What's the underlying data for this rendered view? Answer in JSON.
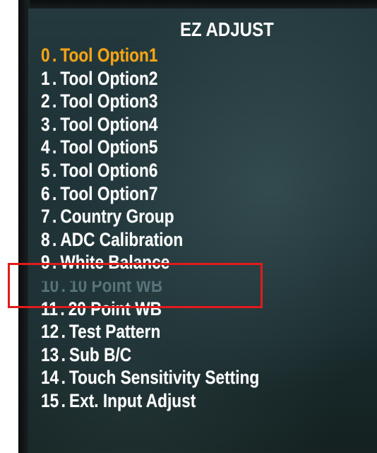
{
  "menu": {
    "title": "EZ ADJUST",
    "items": [
      {
        "num": "0",
        "label": "Tool Option1",
        "state": "selected"
      },
      {
        "num": "1",
        "label": "Tool Option2",
        "state": "normal"
      },
      {
        "num": "2",
        "label": "Tool Option3",
        "state": "normal"
      },
      {
        "num": "3",
        "label": "Tool Option4",
        "state": "normal"
      },
      {
        "num": "4",
        "label": "Tool Option5",
        "state": "normal"
      },
      {
        "num": "5",
        "label": "Tool Option6",
        "state": "normal"
      },
      {
        "num": "6",
        "label": "Tool Option7",
        "state": "normal"
      },
      {
        "num": "7",
        "label": "Country Group",
        "state": "normal"
      },
      {
        "num": "8",
        "label": "ADC Calibration",
        "state": "normal"
      },
      {
        "num": "9",
        "label": "White Balance",
        "state": "normal"
      },
      {
        "num": "10",
        "label": "10 Point WB",
        "state": "dim"
      },
      {
        "num": "11",
        "label": "20 Point WB",
        "state": "normal"
      },
      {
        "num": "12",
        "label": "Test Pattern",
        "state": "normal"
      },
      {
        "num": "13",
        "label": "Sub B/C",
        "state": "normal"
      },
      {
        "num": "14",
        "label": "Touch Sensitivity Setting",
        "state": "normal"
      },
      {
        "num": "15",
        "label": "Ext. Input Adjust",
        "state": "normal"
      }
    ],
    "separator": "."
  },
  "colors": {
    "selected": "#f4a416",
    "normal": "#ffffff",
    "dim": "#5d7b80",
    "highlight_box": "#e21b1b",
    "screen_bg": "#1c3034"
  }
}
